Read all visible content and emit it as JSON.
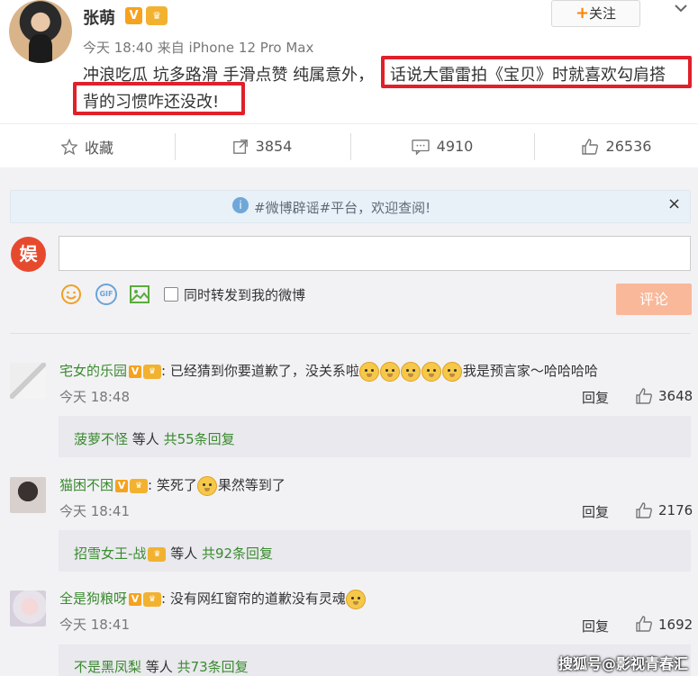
{
  "post": {
    "author": "张萌",
    "verified_badge": "V",
    "vip_badge": "♛",
    "meta": "今天 18:40 来自 iPhone 12 Pro Max",
    "follow_label": "关注",
    "follow_plus": "+",
    "text_part1": "冲浪吃瓜 坑多路滑 手滑点赞 纯属意外，",
    "text_highlight1": "话说大雷雷拍《宝贝》时就喜欢勾肩搭",
    "text_highlight2": "背的习惯咋还没改!",
    "highlight_color": "#e0202a"
  },
  "actions": {
    "favorite": "收藏",
    "repost": "3854",
    "comment": "4910",
    "like": "26536"
  },
  "notice": {
    "text": "#微博辟谣#平台，欢迎查阅!",
    "close": "×"
  },
  "composer": {
    "my_avatar_text": "娱",
    "repost_label": "同时转发到我的微博",
    "submit_label": "评论",
    "gif_label": "GIF"
  },
  "comments": [
    {
      "name": "宅女的乐园",
      "text_before": "已经猜到你要道歉了，没关系啦",
      "emoji_count": 5,
      "text_after": "我是预言家～哈哈哈哈",
      "time": "今天 18:48",
      "reply_label": "回复",
      "likes": "3648",
      "sub_name": "菠萝不怪",
      "sub_mid": " 等人",
      "sub_count": " 共55条回复"
    },
    {
      "name": "猫困不困",
      "text_before": "笑死了",
      "emoji_count": 1,
      "text_after": "果然等到了",
      "time": "今天 18:41",
      "reply_label": "回复",
      "likes": "2176",
      "sub_name": "招雪女王-战",
      "sub_mid": " 等人",
      "sub_count": " 共92条回复"
    },
    {
      "name": "全是狗粮呀",
      "text_before": "没有网红窗帘的道歉没有灵魂",
      "emoji_count": 1,
      "text_after": "",
      "time": "今天 18:41",
      "reply_label": "回复",
      "likes": "1692",
      "sub_name": "不是黑凤梨",
      "sub_mid": " 等人",
      "sub_count": " 共73条回复"
    }
  ],
  "watermark": "搜狐号@影视青春汇",
  "icons": {
    "favorite": "star-icon",
    "repost": "share-icon",
    "comment": "comment-icon",
    "like": "thumbs-up-icon"
  }
}
